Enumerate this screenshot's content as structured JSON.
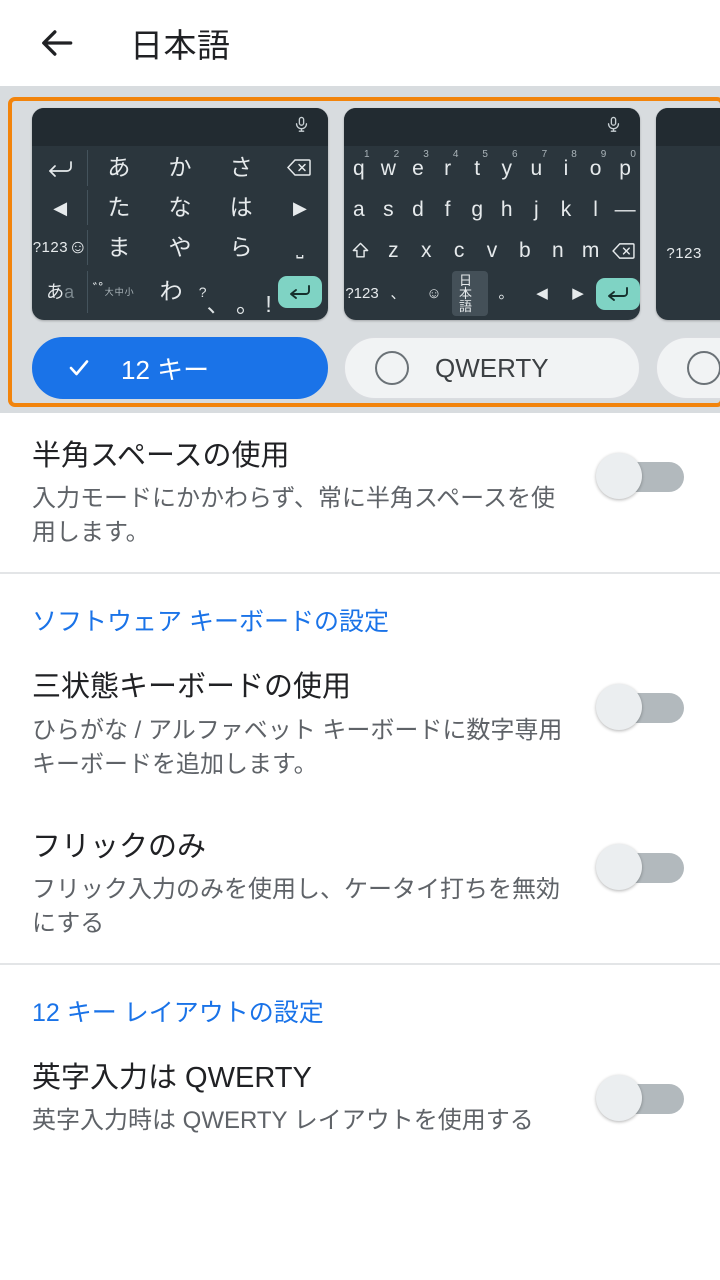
{
  "appbar": {
    "back_icon": "arrow-left-icon",
    "title": "日本語"
  },
  "keyboard_chooser": {
    "highlight_color": "#f2840c",
    "selected_index": 0,
    "options": [
      {
        "label": "12 キー",
        "selected": true,
        "layout": "twelve-key",
        "mic_icon": "microphone-icon",
        "rows": [
          [
            "↶",
            "あ",
            "か",
            "さ",
            "⌫"
          ],
          [
            "◀",
            "た",
            "な",
            "は",
            "▶"
          ],
          [
            "?123",
            "ま",
            "や",
            "ら",
            "␣"
          ],
          [
            "あa",
            "゛゜",
            "わ",
            "、。?!",
            "⏎"
          ]
        ]
      },
      {
        "label": "QWERTY",
        "selected": false,
        "layout": "qwerty",
        "mic_icon": "microphone-icon",
        "row1": [
          "q",
          "w",
          "e",
          "r",
          "t",
          "y",
          "u",
          "i",
          "o",
          "p"
        ],
        "row1_hints": [
          "1",
          "2",
          "3",
          "4",
          "5",
          "6",
          "7",
          "8",
          "9",
          "0"
        ],
        "row2": [
          "a",
          "s",
          "d",
          "f",
          "g",
          "h",
          "j",
          "k",
          "l",
          "—"
        ],
        "row3": [
          "⇧",
          "z",
          "x",
          "c",
          "v",
          "b",
          "n",
          "m",
          "⌫"
        ],
        "row4": [
          "?123",
          "、",
          "☺",
          "日本語",
          "。",
          "◀",
          "▶",
          "⏎"
        ]
      },
      {
        "label": "",
        "selected": false,
        "layout": "partial",
        "rows": [
          [
            "?123"
          ]
        ]
      }
    ]
  },
  "settings": [
    {
      "type": "row",
      "name": "hankaku-space",
      "title": "半角スペースの使用",
      "summary": "入力モードにかかわらず、常に半角スペースを使用します。",
      "toggle": "off"
    },
    {
      "type": "divider"
    },
    {
      "type": "header",
      "name": "software-keyboard-settings",
      "title": "ソフトウェア キーボードの設定"
    },
    {
      "type": "row",
      "name": "three-state-keyboard",
      "title": "三状態キーボードの使用",
      "summary": "ひらがな / アルファベット キーボードに数字専用キーボードを追加します。",
      "toggle": "off"
    },
    {
      "type": "row",
      "name": "flick-only",
      "title": "フリックのみ",
      "summary": "フリック入力のみを使用し、ケータイ打ちを無効にする",
      "toggle": "off"
    },
    {
      "type": "divider"
    },
    {
      "type": "header",
      "name": "twelve-key-layout-settings",
      "title": "12 キー レイアウトの設定"
    },
    {
      "type": "row",
      "name": "alphabet-input-qwerty",
      "title": "英字入力は QWERTY",
      "summary": "英字入力時は QWERTY レイアウトを使用する",
      "toggle": "off"
    }
  ]
}
